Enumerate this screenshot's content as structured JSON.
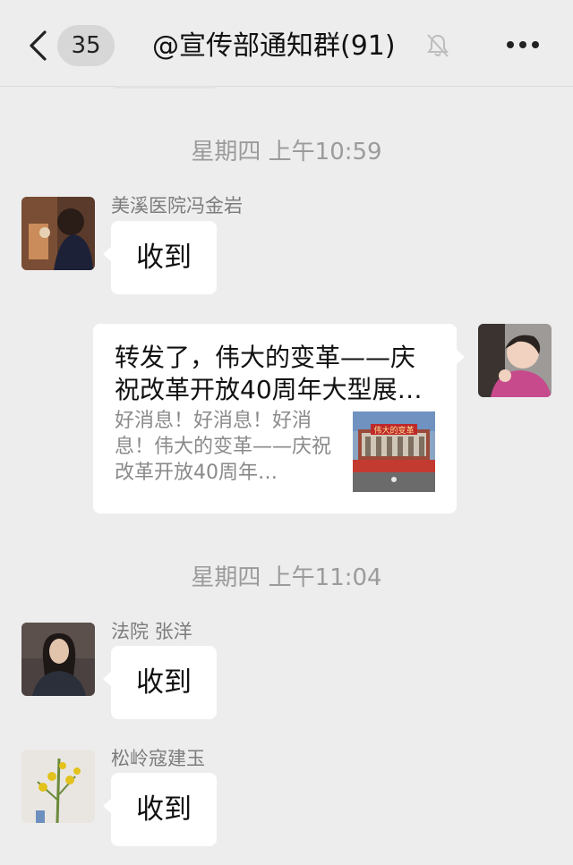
{
  "header": {
    "unread_count": "35",
    "title": "@宣传部通知群(91)",
    "icons": {
      "back": "chevron-left-icon",
      "mute": "bell-off-icon",
      "more": "more-dots-icon"
    }
  },
  "messages": {
    "ts1": "星期四 上午10:59",
    "m1": {
      "sender": "美溪医院冯金岩",
      "text": "收到"
    },
    "m2": {
      "title": "转发了，伟大的变革——庆祝改革开放40周年大型展…",
      "desc": "好消息！好消息！好消息！伟大的变革——庆祝改革开放40周年…",
      "thumb_label": "伟大的变革"
    },
    "ts2": "星期四 上午11:04",
    "m3": {
      "sender": "法院 张洋",
      "text": "收到"
    },
    "m4": {
      "sender": "松岭寇建玉",
      "text": "收到"
    }
  },
  "colors": {
    "background": "#ededed",
    "bubble": "#ffffff",
    "secondary_text": "#9b9b9b"
  }
}
